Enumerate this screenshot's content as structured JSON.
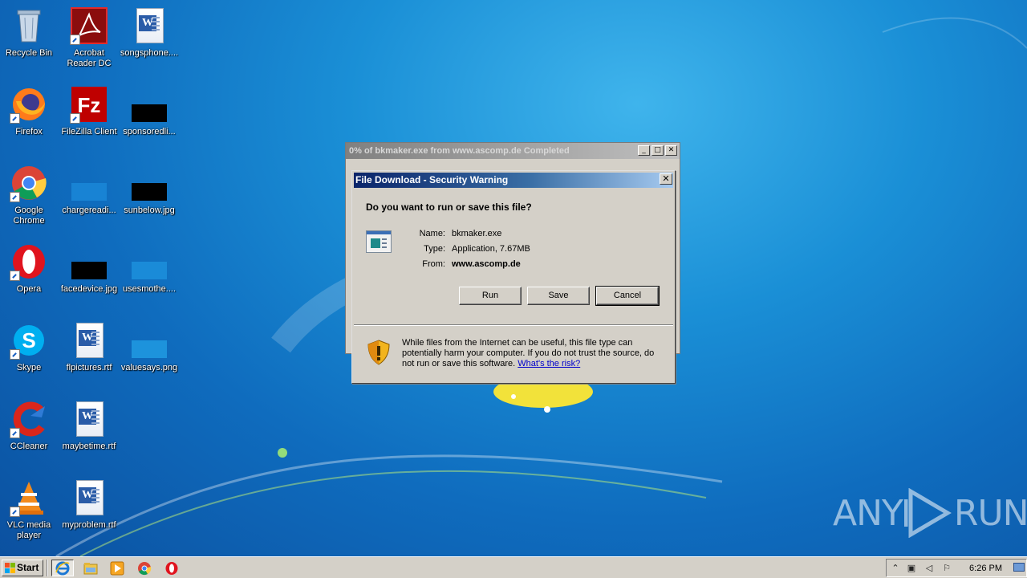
{
  "desktop": {
    "icons": [
      {
        "label": "Recycle Bin",
        "icon": "recycle-bin-icon"
      },
      {
        "label": "Acrobat Reader DC",
        "icon": "acrobat-icon"
      },
      {
        "label": "songsphone....",
        "icon": "word-document-icon"
      },
      {
        "label": "Firefox",
        "icon": "firefox-icon"
      },
      {
        "label": "FileZilla Client",
        "icon": "filezilla-icon"
      },
      {
        "label": "sponsoredli...",
        "icon": "image-file-icon"
      },
      {
        "label": "Google Chrome",
        "icon": "chrome-icon"
      },
      {
        "label": "chargereadi...",
        "icon": "image-file-icon"
      },
      {
        "label": "sunbelow.jpg",
        "icon": "image-file-icon"
      },
      {
        "label": "Opera",
        "icon": "opera-icon"
      },
      {
        "label": "facedevice.jpg",
        "icon": "image-file-icon"
      },
      {
        "label": "usesmothe....",
        "icon": "image-file-icon"
      },
      {
        "label": "Skype",
        "icon": "skype-icon"
      },
      {
        "label": "flpictures.rtf",
        "icon": "word-document-icon"
      },
      {
        "label": "valuesays.png",
        "icon": "image-file-icon"
      },
      {
        "label": "CCleaner",
        "icon": "ccleaner-icon"
      },
      {
        "label": "maybetime.rtf",
        "icon": "word-document-icon"
      },
      {
        "label": "VLC media player",
        "icon": "vlc-icon"
      },
      {
        "label": "myproblem.rtf",
        "icon": "word-document-icon"
      }
    ]
  },
  "background_window": {
    "title": "0% of bkmaker.exe from www.ascomp.de Completed",
    "minimize": "_",
    "maximize": "□",
    "close": "✕"
  },
  "dialog": {
    "title": "File Download - Security Warning",
    "close": "✕",
    "question": "Do you want to run or save this file?",
    "name_label": "Name:",
    "name_value": "bkmaker.exe",
    "type_label": "Type:",
    "type_value": "Application, 7.67MB",
    "from_label": "From:",
    "from_value": "www.ascomp.de",
    "run_label": "Run",
    "save_label": "Save",
    "cancel_label": "Cancel",
    "warning_text": "While files from the Internet can be useful, this file type can potentially harm your computer. If you do not trust the source, do not run or save this software. ",
    "risk_link": "What's the risk?"
  },
  "taskbar": {
    "start_label": "Start",
    "time": "6:26 PM",
    "pinned": [
      "internet-explorer-icon",
      "explorer-folder-icon",
      "media-player-icon",
      "chrome-icon",
      "opera-icon"
    ]
  },
  "watermark": {
    "left": "ANY",
    "right": "RUN"
  },
  "colors": {
    "desktop_blue": "#1a8fd6",
    "dialog_face": "#d4d0c8",
    "title_active": "#0a246a",
    "title_inactive": "#808080",
    "link": "#0000cc"
  }
}
